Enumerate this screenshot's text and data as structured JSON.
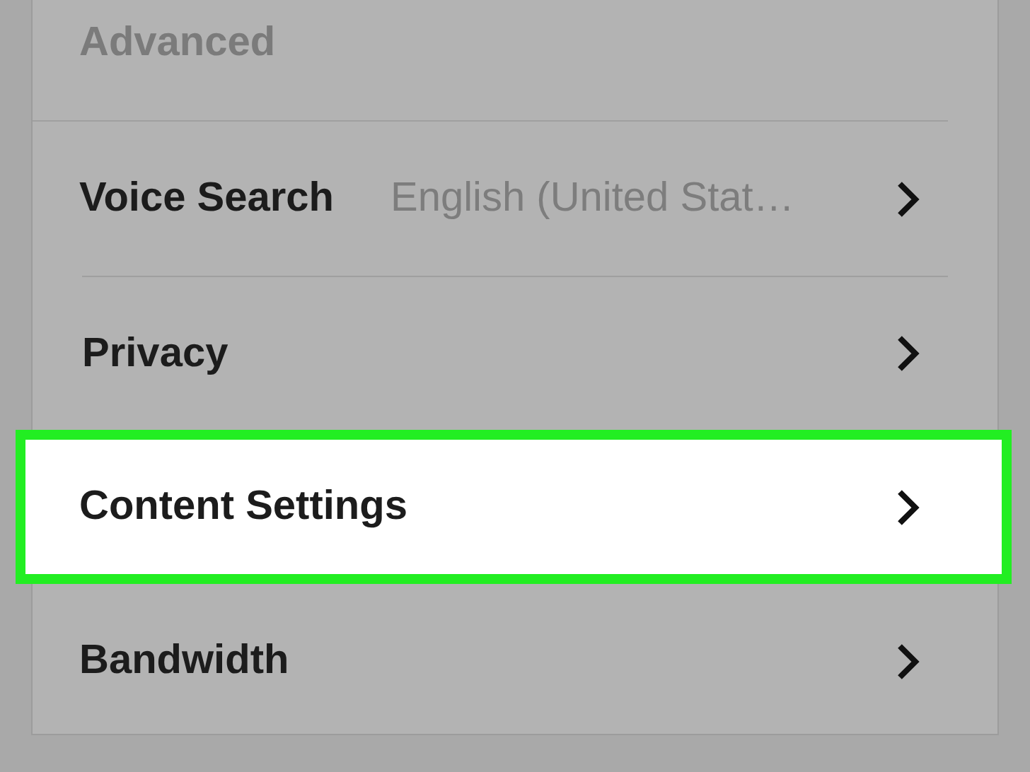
{
  "section": {
    "title": "Advanced"
  },
  "items": [
    {
      "label": "Voice Search",
      "value": "English (United Stat…",
      "selected": false
    },
    {
      "label": "Privacy",
      "selected": false
    },
    {
      "label": "Content Settings",
      "selected": true
    },
    {
      "label": "Bandwidth",
      "selected": false
    }
  ]
}
